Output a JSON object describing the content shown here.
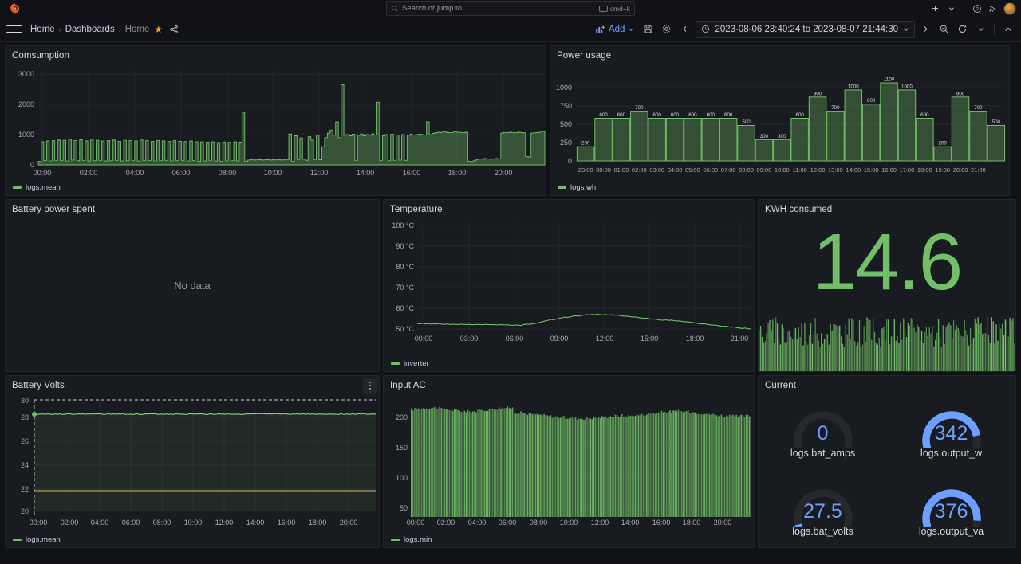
{
  "topbar": {
    "logo_icon": "grafana-logo-icon",
    "search_placeholder": "Search or jump to...",
    "search_icon": "search-icon",
    "kbd_shortcut": "cmd+k",
    "add_icon": "plus-icon",
    "chevron_icon": "chevron-down-icon",
    "help_icon": "help-circle-icon",
    "news_icon": "rss-news-icon",
    "avatar_icon": "user-avatar"
  },
  "navbar": {
    "menu_icon": "hamburger-menu-icon",
    "breadcrumbs": [
      {
        "label": "Home",
        "current": false
      },
      {
        "label": "Dashboards",
        "current": false
      },
      {
        "label": "Home",
        "current": true
      }
    ],
    "separator": "›",
    "star_icon": "star-filled-icon",
    "share_icon": "share-nodes-icon",
    "add_label": "Add",
    "add_icon": "panel-add-icon",
    "save_icon": "save-disk-icon",
    "settings_icon": "gear-icon",
    "time_prev_icon": "chevron-left-icon",
    "time_next_icon": "chevron-right-icon",
    "clock_icon": "clock-icon",
    "time_range": "2023-08-06 23:40:24 to 2023-08-07 21:44:30",
    "zoom_out_icon": "zoom-out-icon",
    "refresh_icon": "refresh-icon",
    "collapse_icon": "chevron-up-icon"
  },
  "panels": {
    "consumption": {
      "title": "Comsumption",
      "legend": "logs.mean"
    },
    "power_usage": {
      "title": "Power usage",
      "legend": "logs.wh"
    },
    "battery_power_spent": {
      "title": "Battery power spent",
      "no_data": "No data"
    },
    "temperature": {
      "title": "Temperature",
      "legend": "inverter"
    },
    "kwh_consumed": {
      "title": "KWH consumed",
      "value": "14.6"
    },
    "battery_volts": {
      "title": "Battery Volts",
      "legend": "logs.mean",
      "menu_icon": "panel-menu-icon"
    },
    "input_ac": {
      "title": "Input AC",
      "legend": "logs.min"
    },
    "current": {
      "title": "Current",
      "gauges": [
        {
          "value": "0",
          "label": "logs.bat_amps",
          "pct": 0.0
        },
        {
          "value": "342",
          "label": "logs.output_w",
          "pct": 0.86
        },
        {
          "value": "27.5",
          "label": "logs.bat_volts",
          "pct": 0.03
        },
        {
          "value": "376",
          "label": "logs.output_va",
          "pct": 0.93
        }
      ]
    }
  },
  "colors": {
    "green_series": "#73bf69",
    "blue_gauge": "#6e9fff",
    "threshold_yellow": "#b89a5e",
    "panel_bg": "#181b1f",
    "page_bg": "#111217",
    "text": "#ccccdc"
  },
  "chart_data": [
    {
      "id": "consumption",
      "type": "area",
      "title": "Comsumption",
      "ylabel": "",
      "xlabel": "",
      "ylim": [
        0,
        3000
      ],
      "yticks": [
        "0",
        "1000",
        "2000",
        "3000"
      ],
      "xticks": [
        "00:00",
        "02:00",
        "04:00",
        "06:00",
        "08:00",
        "10:00",
        "12:00",
        "14:00",
        "16:00",
        "18:00",
        "20:00"
      ],
      "series": [
        {
          "name": "logs.mean",
          "color": "#73bf69",
          "values": [
            120,
            760,
            140,
            790,
            130,
            800,
            150,
            820,
            140,
            810,
            130,
            840,
            160,
            800,
            140,
            830,
            150,
            790,
            130,
            820,
            140,
            810,
            150,
            790,
            130,
            800,
            140,
            820,
            150,
            780,
            130,
            810,
            140,
            800,
            150,
            790,
            130,
            820,
            140,
            800,
            150,
            780,
            130,
            800,
            140,
            790,
            150,
            770,
            130,
            800,
            140,
            780,
            150,
            770,
            130,
            790,
            140,
            760,
            120,
            760,
            130,
            750,
            140,
            760,
            130,
            740,
            120,
            755,
            130,
            745,
            140,
            760,
            130,
            750,
            1740,
            120,
            160,
            170,
            160,
            180,
            170,
            160,
            180,
            170,
            160,
            175,
            165,
            170,
            160,
            175,
            165,
            1020,
            120,
            960,
            180,
            890,
            190,
            150,
            930,
            820,
            180,
            980,
            170,
            600,
            900,
            1050,
            1150,
            980,
            1420,
            900,
            2650,
            980,
            1000,
            960,
            1010,
            150,
            980,
            1020,
            960,
            1000,
            980,
            1020,
            990,
            2070,
            150,
            960,
            1000,
            140,
            1010,
            150,
            990,
            160,
            1000,
            150,
            980,
            1010,
            990,
            1000,
            1010,
            1000,
            990,
            1420,
            1000,
            1040,
            1060,
            1080,
            1070,
            1090,
            1080,
            1060,
            1070,
            1090,
            1080,
            1070,
            1060,
            1080,
            120,
            110,
            140,
            180,
            200,
            190,
            210,
            200,
            190,
            200,
            210,
            200,
            1050,
            1070,
            1060,
            1080,
            1070,
            1060,
            1080,
            1070,
            1060,
            280,
            260,
            1050,
            1060,
            1070,
            1080,
            1100
          ]
        }
      ],
      "grid": true,
      "legend_position": "bottom"
    },
    {
      "id": "power_usage",
      "type": "bar",
      "title": "Power usage",
      "ylabel": "",
      "xlabel": "",
      "ylim": [
        0,
        1100
      ],
      "yticks": [
        "0",
        "250",
        "500",
        "750",
        "1000"
      ],
      "categories": [
        "23:00",
        "00:00",
        "01:00",
        "02:00",
        "03:00",
        "04:00",
        "05:00",
        "06:00",
        "07:00",
        "08:00",
        "09:00",
        "10:00",
        "11:00",
        "12:00",
        "13:00",
        "14:00",
        "15:00",
        "16:00",
        "17:00",
        "18:00",
        "19:00",
        "20:00",
        "21:00"
      ],
      "values": [
        200,
        600,
        600,
        700,
        600,
        600,
        600,
        600,
        600,
        500,
        300,
        300,
        600,
        900,
        700,
        1000,
        800,
        1100,
        1000,
        600,
        200,
        900,
        700,
        500
      ],
      "data_labels": [
        "200",
        "600",
        "600",
        "700",
        "600",
        "600",
        "600",
        "600",
        "600",
        "500",
        "300",
        "300",
        "600",
        "900",
        "700",
        "1000",
        "800",
        "1100",
        "1000",
        "600",
        "200",
        "900",
        "700",
        "500"
      ],
      "series_name": "logs.wh",
      "color": "#73bf69",
      "grid": true,
      "legend_position": "bottom"
    },
    {
      "id": "battery_power_spent",
      "type": "line",
      "title": "Battery power spent",
      "empty_message": "No data",
      "series": []
    },
    {
      "id": "temperature",
      "type": "line",
      "title": "Temperature",
      "ylabel": "°C",
      "xlabel": "",
      "ylim": [
        45,
        100
      ],
      "yticks": [
        "50 °C",
        "60 °C",
        "70 °C",
        "80 °C",
        "90 °C",
        "100 °C"
      ],
      "xticks": [
        "00:00",
        "03:00",
        "06:00",
        "09:00",
        "12:00",
        "15:00",
        "18:00",
        "21:00"
      ],
      "series": [
        {
          "name": "inverter",
          "color": "#73bf69",
          "values": [
            52.3,
            52.2,
            52.4,
            52.1,
            52.3,
            52.0,
            52.2,
            52.1,
            52.3,
            52.0,
            51.9,
            52.1,
            51.8,
            52.0,
            51.9,
            51.8,
            52.0,
            51.9,
            51.8,
            51.9,
            51.7,
            51.8,
            51.9,
            51.8,
            51.7,
            51.9,
            51.8,
            51.7,
            51.8,
            51.6,
            51.7,
            51.8,
            51.6,
            51.7,
            51.5,
            51.4,
            51.6,
            51.5,
            51.3,
            51.8,
            52.0,
            51.9,
            52.1,
            52.3,
            52.6,
            52.9,
            53.2,
            53.6,
            53.9,
            54.3,
            54.1,
            54.5,
            54.8,
            55.1,
            55.4,
            55.2,
            55.6,
            55.9,
            56.1,
            55.9,
            56.2,
            56.4,
            56.6,
            56.5,
            56.7,
            56.6,
            56.8,
            56.6,
            56.5,
            56.7,
            56.4,
            56.6,
            56.3,
            56.5,
            56.2,
            56.0,
            55.8,
            55.9,
            55.6,
            55.4,
            55.5,
            55.2,
            55.0,
            54.8,
            54.9,
            54.6,
            54.4,
            54.5,
            54.2,
            54.0,
            53.9,
            54.1,
            53.8,
            54.0,
            53.7,
            53.5,
            53.6,
            53.3,
            53.1,
            53.2,
            52.9,
            52.7,
            52.5,
            52.3,
            52.1,
            52.2,
            51.9,
            51.7,
            51.5,
            51.6,
            51.3,
            51.1,
            50.9,
            51.0,
            50.7,
            50.5,
            50.6,
            50.3,
            50.1,
            49.9,
            50.1,
            49.8,
            49.6
          ]
        }
      ],
      "grid": true,
      "legend_position": "bottom"
    },
    {
      "id": "kwh_consumed",
      "type": "stat",
      "title": "KWH consumed",
      "value": 14.6,
      "display_value": "14.6",
      "color": "#73bf69",
      "has_sparkline": true
    },
    {
      "id": "battery_volts",
      "type": "area",
      "title": "Battery Volts",
      "ylim": [
        20,
        30
      ],
      "yticks": [
        "20",
        "22",
        "24",
        "26",
        "28",
        "30"
      ],
      "xticks": [
        "00:00",
        "02:00",
        "04:00",
        "06:00",
        "08:00",
        "10:00",
        "12:00",
        "14:00",
        "16:00",
        "18:00",
        "20:00"
      ],
      "threshold": {
        "value": 22,
        "color": "#b89a5e"
      },
      "series": [
        {
          "name": "logs.mean",
          "color": "#73bf69",
          "constant_value": 27.5
        }
      ],
      "grid": true,
      "legend_position": "bottom"
    },
    {
      "id": "input_ac",
      "type": "bar",
      "title": "Input AC",
      "ylim": [
        0,
        230
      ],
      "yticks": [
        "50",
        "100",
        "150",
        "200"
      ],
      "xticks": [
        "00:00",
        "02:00",
        "04:00",
        "06:00",
        "08:00",
        "10:00",
        "12:00",
        "14:00",
        "16:00",
        "18:00",
        "20:00"
      ],
      "series_name": "logs.min",
      "color": "#73bf69",
      "approx_range": [
        196,
        218
      ],
      "grid": true,
      "legend_position": "bottom"
    },
    {
      "id": "current",
      "type": "gauge",
      "title": "Current",
      "gauges": [
        {
          "label": "logs.bat_amps",
          "value": 0,
          "display": "0"
        },
        {
          "label": "logs.output_w",
          "value": 342,
          "display": "342"
        },
        {
          "label": "logs.bat_volts",
          "value": 27.5,
          "display": "27.5"
        },
        {
          "label": "logs.output_va",
          "value": 376,
          "display": "376"
        }
      ],
      "color": "#6e9fff"
    }
  ]
}
